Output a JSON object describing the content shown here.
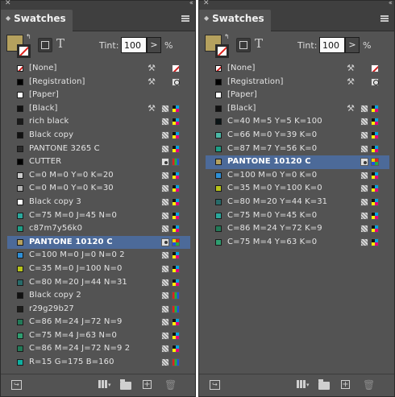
{
  "panels": [
    {
      "title": "Swatches",
      "tint_label": "Tint:",
      "tint_value": "100",
      "tint_unit": "%",
      "tint_arrow": ">",
      "text_toggle": "T",
      "swatches": [
        {
          "name": "[None]",
          "chip": "none",
          "lock": true,
          "icon1": "",
          "icon2": "none-icon"
        },
        {
          "name": "[Registration]",
          "chip": "#000000",
          "lock": true,
          "icon1": "",
          "icon2": "registration-icon"
        },
        {
          "name": "[Paper]",
          "chip": "#ffffff",
          "lock": false,
          "icon1": "",
          "icon2": ""
        },
        {
          "name": "[Black]",
          "chip": "#111111",
          "lock": true,
          "icon1": "process-icon",
          "icon2": "cmyk-icon"
        },
        {
          "name": "rich black",
          "chip": "#1a1a1a",
          "lock": false,
          "icon1": "process-icon",
          "icon2": "cmyk-icon"
        },
        {
          "name": "Black copy",
          "chip": "#111111",
          "lock": false,
          "icon1": "process-icon",
          "icon2": "cmyk-icon"
        },
        {
          "name": "PANTONE 3265 C",
          "chip": "#2a2a2a",
          "lock": false,
          "icon1": "process-icon",
          "icon2": "cmyk-icon"
        },
        {
          "name": "CUTTER",
          "chip": "#000000",
          "lock": false,
          "icon1": "spot-icon",
          "icon2": "rgb-icon"
        },
        {
          "name": "C=0 M=0 Y=0 K=20",
          "chip": "#cccccc",
          "lock": false,
          "icon1": "process-icon",
          "icon2": "cmyk-icon"
        },
        {
          "name": "C=0 M=0 Y=0 K=30",
          "chip": "#b3b3b3",
          "lock": false,
          "icon1": "process-icon",
          "icon2": "cmyk-icon"
        },
        {
          "name": "Black copy 3",
          "chip": "#ffffff",
          "lock": false,
          "icon1": "process-icon",
          "icon2": "cmyk-icon"
        },
        {
          "name": "C=75 M=0 J=45 N=0",
          "chip": "#2aa89c",
          "lock": false,
          "icon1": "process-icon",
          "icon2": "cmyk-icon"
        },
        {
          "name": "c87m7y56k0",
          "chip": "#1e9e86",
          "lock": false,
          "icon1": "process-icon",
          "icon2": "cmyk-icon"
        },
        {
          "name": "PANTONE 10120 C",
          "chip": "#b5a15e",
          "lock": false,
          "icon1": "spot-icon",
          "icon2": "lab-icon",
          "selected": true
        },
        {
          "name": "C=100 M=0 J=0 N=0 2",
          "chip": "#2e8fd6",
          "lock": false,
          "icon1": "process-icon",
          "icon2": "cmyk-icon"
        },
        {
          "name": "C=35 M=0 J=100 N=0",
          "chip": "#b8c41a",
          "lock": false,
          "icon1": "process-icon",
          "icon2": "cmyk-icon"
        },
        {
          "name": "C=80 M=20 J=44 N=31",
          "chip": "#276b6a",
          "lock": false,
          "icon1": "process-icon",
          "icon2": "cmyk-icon"
        },
        {
          "name": "Black copy 2",
          "chip": "#111111",
          "lock": false,
          "icon1": "process-icon",
          "icon2": "rgb-icon"
        },
        {
          "name": "r29g29b27",
          "chip": "#1d1d1b",
          "lock": false,
          "icon1": "process-icon",
          "icon2": "rgb-icon"
        },
        {
          "name": "C=86 M=24 J=72 N=9",
          "chip": "#227a58",
          "lock": false,
          "icon1": "process-icon",
          "icon2": "cmyk-icon"
        },
        {
          "name": "C=75 M=4 J=63 N=0",
          "chip": "#2f9e70",
          "lock": false,
          "icon1": "process-icon",
          "icon2": "cmyk-icon"
        },
        {
          "name": "C=86 M=24 J=72 N=9 2",
          "chip": "#227a58",
          "lock": false,
          "icon1": "process-icon",
          "icon2": "cmyk-icon"
        },
        {
          "name": "R=15 G=175 B=160",
          "chip": "#0fafa0",
          "lock": false,
          "icon1": "process-icon",
          "icon2": "rgb-icon"
        }
      ]
    },
    {
      "title": "Swatches",
      "tint_label": "Tint:",
      "tint_value": "100",
      "tint_unit": "%",
      "tint_arrow": ">",
      "text_toggle": "T",
      "swatches": [
        {
          "name": "[None]",
          "chip": "none",
          "lock": true,
          "icon1": "",
          "icon2": "none-icon"
        },
        {
          "name": "[Registration]",
          "chip": "#000000",
          "lock": true,
          "icon1": "",
          "icon2": "registration-icon"
        },
        {
          "name": "[Paper]",
          "chip": "#ffffff",
          "lock": false,
          "icon1": "",
          "icon2": ""
        },
        {
          "name": "[Black]",
          "chip": "#111111",
          "lock": true,
          "icon1": "process-icon",
          "icon2": "cmyk-icon"
        },
        {
          "name": "C=40 M=5 Y=5 K=100",
          "chip": "#0a1416",
          "lock": false,
          "icon1": "process-icon",
          "icon2": "cmyk-icon"
        },
        {
          "name": "C=66 M=0 Y=39 K=0",
          "chip": "#4bb8a6",
          "lock": false,
          "icon1": "process-icon",
          "icon2": "cmyk-icon"
        },
        {
          "name": "C=87 M=7 Y=56 K=0",
          "chip": "#1e9e86",
          "lock": false,
          "icon1": "process-icon",
          "icon2": "cmyk-icon"
        },
        {
          "name": "PANTONE 10120 C",
          "chip": "#b5a15e",
          "lock": false,
          "icon1": "spot-icon",
          "icon2": "lab-icon",
          "selected": true
        },
        {
          "name": "C=100 M=0 Y=0 K=0",
          "chip": "#2e8fd6",
          "lock": false,
          "icon1": "process-icon",
          "icon2": "cmyk-icon"
        },
        {
          "name": "C=35 M=0 Y=100 K=0",
          "chip": "#b8c41a",
          "lock": false,
          "icon1": "process-icon",
          "icon2": "cmyk-icon"
        },
        {
          "name": "C=80 M=20 Y=44 K=31",
          "chip": "#276b6a",
          "lock": false,
          "icon1": "process-icon",
          "icon2": "cmyk-icon"
        },
        {
          "name": "C=75 M=0 Y=45 K=0",
          "chip": "#2aa89c",
          "lock": false,
          "icon1": "process-icon",
          "icon2": "cmyk-icon"
        },
        {
          "name": "C=86 M=24 Y=72 K=9",
          "chip": "#227a58",
          "lock": false,
          "icon1": "process-icon",
          "icon2": "cmyk-icon"
        },
        {
          "name": "C=75 M=4 Y=63 K=0",
          "chip": "#2f9e70",
          "lock": false,
          "icon1": "process-icon",
          "icon2": "cmyk-icon"
        }
      ]
    }
  ]
}
